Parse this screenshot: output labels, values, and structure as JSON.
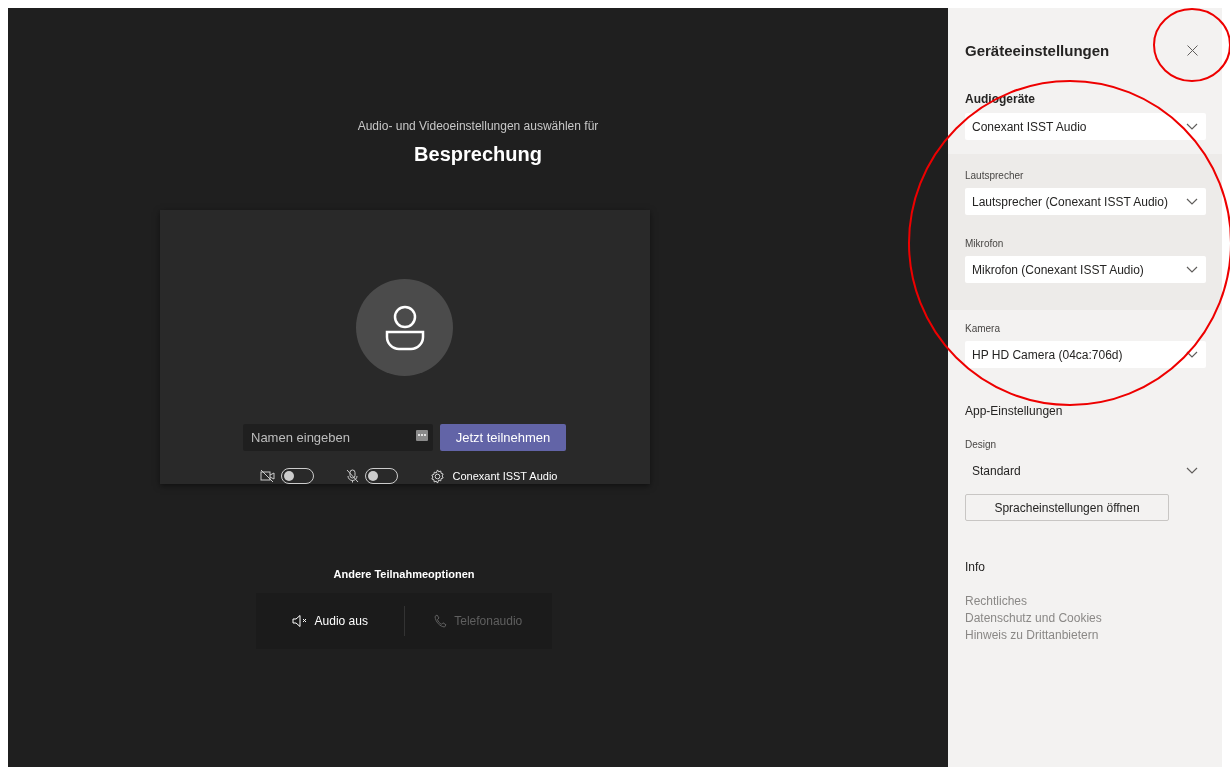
{
  "meeting": {
    "subtitle": "Audio- und Videoeinstellungen auswählen für",
    "title": "Besprechung",
    "name_field": {
      "placeholder": "Namen eingeben"
    },
    "join_button": "Jetzt teilnehmen",
    "toggles": [
      {
        "kind": "camera",
        "on": false
      },
      {
        "kind": "microphone",
        "on": false
      }
    ],
    "audio_device": "Conexant ISST Audio"
  },
  "other_options": {
    "title": "Andere Teilnahmeoptionen",
    "options": [
      {
        "kind": "audio-off",
        "label": "Audio aus",
        "disabled": false
      },
      {
        "kind": "phone",
        "label": "Telefonaudio",
        "disabled": true
      }
    ]
  },
  "settings_panel": {
    "title": "Geräteeinstellungen",
    "audio_devices": {
      "heading": "Audiogeräte",
      "value": "Conexant ISST Audio"
    },
    "speaker": {
      "label": "Lautsprecher",
      "value": "Lautsprecher (Conexant ISST Audio)"
    },
    "microphone": {
      "label": "Mikrofon",
      "value": "Mikrofon (Conexant ISST Audio)"
    },
    "camera": {
      "label": "Kamera",
      "value": "HP HD Camera (04ca:706d)"
    },
    "app_settings": {
      "heading": "App-Einstellungen",
      "design": {
        "label": "Design",
        "value": "Standard"
      },
      "language_button": "Spracheinstellungen öffnen"
    },
    "info": {
      "heading": "Info",
      "links": [
        "Rechtliches",
        "Datenschutz und Cookies",
        "Hinweis zu Drittanbietern"
      ]
    }
  }
}
